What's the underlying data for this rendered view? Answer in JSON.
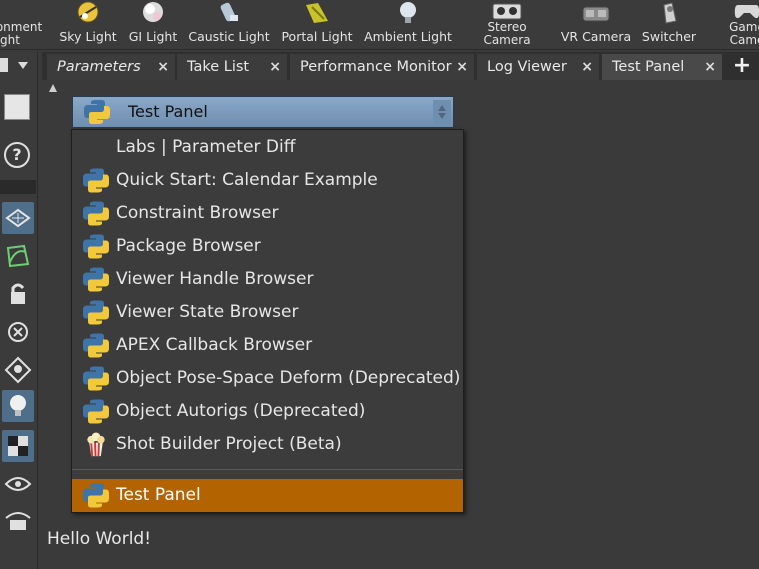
{
  "shelf": {
    "tools": [
      {
        "line1": "onment",
        "line2": "ght",
        "icon": "environment-light-icon"
      },
      {
        "label": "Sky Light",
        "icon": "sky-light-icon"
      },
      {
        "label": "GI Light",
        "icon": "gi-light-icon"
      },
      {
        "label": "Caustic Light",
        "icon": "caustic-light-icon"
      },
      {
        "label": "Portal Light",
        "icon": "portal-light-icon"
      },
      {
        "label": "Ambient Light",
        "icon": "ambient-light-icon"
      },
      {
        "line1": "Stereo",
        "line2": "Camera",
        "icon": "stereo-camera-icon"
      },
      {
        "label": "VR Camera",
        "icon": "vr-camera-icon"
      },
      {
        "label": "Switcher",
        "icon": "switcher-icon"
      },
      {
        "line1": "Game",
        "line2": "Came",
        "icon": "gamepad-camera-icon"
      }
    ]
  },
  "tabs": [
    {
      "label": "Parameters",
      "close": "×"
    },
    {
      "label": "Take List",
      "close": "×"
    },
    {
      "label": "Performance Monitor",
      "close": "×"
    },
    {
      "label": "Log Viewer",
      "close": "×"
    },
    {
      "label": "Test Panel",
      "close": "×"
    }
  ],
  "add_tab": "+",
  "panel": {
    "selector_value": "Test Panel",
    "body_text": "Hello World!"
  },
  "menu": {
    "items": [
      {
        "label": "Labs | Parameter Diff",
        "icon": "none"
      },
      {
        "label": "Quick Start: Calendar Example",
        "icon": "python-icon"
      },
      {
        "label": "Constraint Browser",
        "icon": "python-icon"
      },
      {
        "label": "Package Browser",
        "icon": "python-icon"
      },
      {
        "label": "Viewer Handle Browser",
        "icon": "python-icon"
      },
      {
        "label": "Viewer State Browser",
        "icon": "python-icon"
      },
      {
        "label": "APEX Callback Browser",
        "icon": "python-icon"
      },
      {
        "label": "Object Pose-Space Deform (Deprecated)",
        "icon": "python-icon"
      },
      {
        "label": "Object Autorigs (Deprecated)",
        "icon": "python-icon"
      },
      {
        "label": "Shot Builder Project (Beta)",
        "icon": "popcorn-icon"
      }
    ],
    "selected": {
      "label": "Test Panel",
      "icon": "python-icon"
    }
  },
  "colors": {
    "selection": "#b36400",
    "dropdown_button": "#7f9fc0",
    "background": "#3a3a3a"
  }
}
